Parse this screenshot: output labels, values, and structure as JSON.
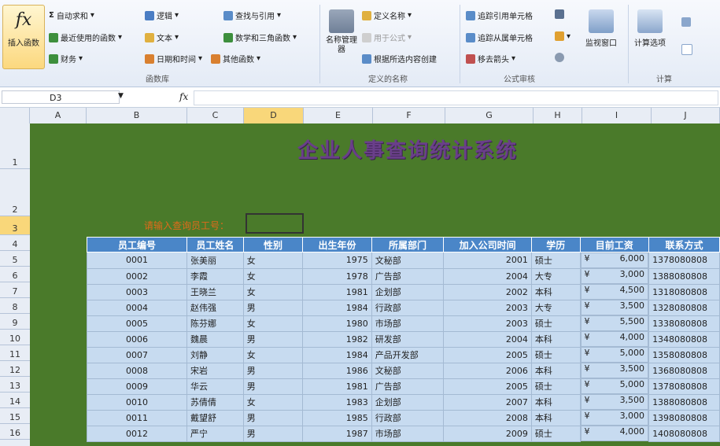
{
  "ribbon": {
    "insert_function": "插入函数",
    "autosum": "自动求和",
    "recently_used": "最近使用的函数",
    "financial": "财务",
    "logical": "逻辑",
    "text": "文本",
    "datetime": "日期和时间",
    "lookup": "查找与引用",
    "math": "数学和三角函数",
    "more": "其他函数",
    "group_library": "函数库",
    "define_name": "定义名称",
    "use_in_formula": "用于公式",
    "create_from_selection": "根据所选内容创建",
    "name_manager": "名称管理器",
    "group_names": "定义的名称",
    "trace_precedents": "追踪引用单元格",
    "trace_dependents": "追踪从属单元格",
    "remove_arrows": "移去箭头",
    "watch_window": "监视窗口",
    "group_audit": "公式审核",
    "calc_options": "计算选项",
    "group_calc": "计算"
  },
  "formula_bar": {
    "name_box": "D3",
    "fx": "fx",
    "value": ""
  },
  "columns": [
    "A",
    "B",
    "C",
    "D",
    "E",
    "F",
    "G",
    "H",
    "I",
    "J"
  ],
  "rows": [
    "1",
    "2",
    "3",
    "4",
    "5",
    "6",
    "7",
    "8",
    "9",
    "10",
    "11",
    "12",
    "13",
    "14",
    "15",
    "16"
  ],
  "sheet": {
    "title": "企业人事查询统计系统",
    "search_label": "请输入查询员工号："
  },
  "table": {
    "headers": [
      "员工编号",
      "员工姓名",
      "性别",
      "出生年份",
      "所属部门",
      "加入公司时间",
      "学历",
      "目前工资",
      "联系方式"
    ],
    "rows": [
      [
        "0001",
        "张美丽",
        "女",
        "1975",
        "文秘部",
        "2001",
        "硕士",
        "¥",
        "6,000",
        "1378080808"
      ],
      [
        "0002",
        "李霞",
        "女",
        "1978",
        "广告部",
        "2004",
        "大专",
        "¥",
        "3,000",
        "1388080808"
      ],
      [
        "0003",
        "王晓兰",
        "女",
        "1981",
        "企划部",
        "2002",
        "本科",
        "¥",
        "4,500",
        "1318080808"
      ],
      [
        "0004",
        "赵伟强",
        "男",
        "1984",
        "行政部",
        "2003",
        "大专",
        "¥",
        "3,500",
        "1328080808"
      ],
      [
        "0005",
        "陈芬娜",
        "女",
        "1980",
        "市场部",
        "2003",
        "硕士",
        "¥",
        "5,500",
        "1338080808"
      ],
      [
        "0006",
        "魏晨",
        "男",
        "1982",
        "研发部",
        "2004",
        "本科",
        "¥",
        "4,000",
        "1348080808"
      ],
      [
        "0007",
        "刘静",
        "女",
        "1984",
        "产品开发部",
        "2005",
        "硕士",
        "¥",
        "5,000",
        "1358080808"
      ],
      [
        "0008",
        "宋岩",
        "男",
        "1986",
        "文秘部",
        "2006",
        "本科",
        "¥",
        "3,500",
        "1368080808"
      ],
      [
        "0009",
        "华云",
        "男",
        "1981",
        "广告部",
        "2005",
        "硕士",
        "¥",
        "5,000",
        "1378080808"
      ],
      [
        "0010",
        "苏倩倩",
        "女",
        "1983",
        "企划部",
        "2007",
        "本科",
        "¥",
        "3,500",
        "1388080808"
      ],
      [
        "0011",
        "戴望舒",
        "男",
        "1985",
        "行政部",
        "2008",
        "本科",
        "¥",
        "3,000",
        "1398080808"
      ],
      [
        "0012",
        "严宁",
        "男",
        "1987",
        "市场部",
        "2009",
        "硕士",
        "¥",
        "4,000",
        "1408080808"
      ]
    ]
  }
}
